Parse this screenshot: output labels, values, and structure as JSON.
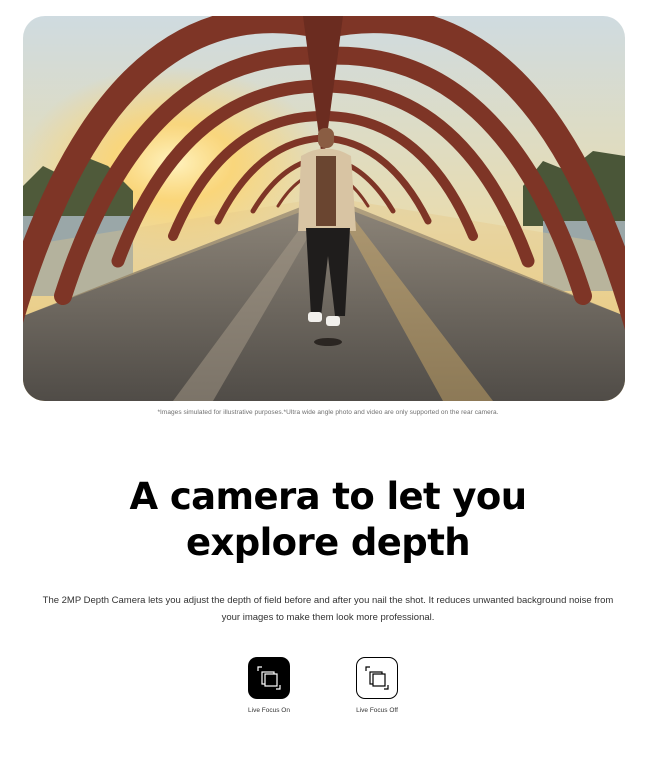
{
  "hero": {
    "image_description": "Man riding a skateboard on an arched bridge at sunset"
  },
  "disclaimer": "*Images simulated for illustrative purposes.*Ultra wide angle photo and video are only supported on the rear camera.",
  "headline": {
    "line1": "A camera to let you",
    "line2": "explore depth"
  },
  "body_text": "The 2MP Depth Camera lets you adjust the depth of field before and after you nail the shot. It reduces unwanted background noise from your images to make them look more professional.",
  "focus_modes": [
    {
      "label": "Live Focus On",
      "icon": "live-focus-on-icon",
      "state": "selected"
    },
    {
      "label": "Live Focus Off",
      "icon": "live-focus-off-icon",
      "state": "unselected"
    }
  ],
  "colors": {
    "bridge_arch": "#8a3b2c",
    "sky": "#d9d3b8",
    "sun": "#ffd36b",
    "deck": "#6a6660",
    "button_dark": "#000000"
  }
}
